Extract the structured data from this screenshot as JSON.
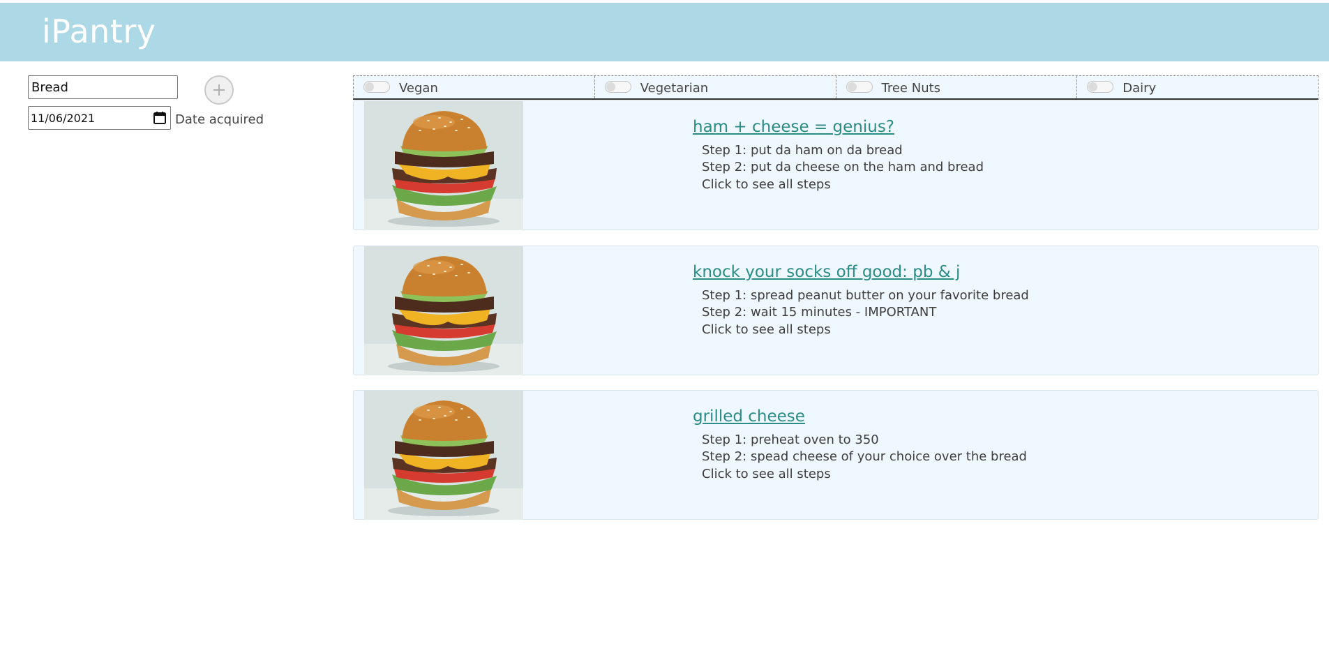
{
  "app": {
    "title": "iPantry"
  },
  "add_item": {
    "item_value": "Bread",
    "date_value": "11/06/2021",
    "date_label": "Date acquired"
  },
  "filters": [
    {
      "label": "Vegan",
      "on": false
    },
    {
      "label": "Vegetarian",
      "on": false
    },
    {
      "label": "Tree Nuts",
      "on": false
    },
    {
      "label": "Dairy",
      "on": false
    }
  ],
  "recipes": [
    {
      "title": "ham + cheese = genius?",
      "steps": [
        "Step 1: put da ham on da bread",
        "Step 2: put da cheese on the ham and bread"
      ],
      "see_all": "Click to see all steps"
    },
    {
      "title": "knock your socks off good: pb & j",
      "steps": [
        "Step 1: spread peanut butter on your favorite bread",
        "Step 2: wait 15 minutes - IMPORTANT"
      ],
      "see_all": "Click to see all steps"
    },
    {
      "title": "grilled cheese",
      "steps": [
        "Step 1: preheat oven to 350",
        "Step 2: spead cheese of your choice over the bread"
      ],
      "see_all": "Click to see all steps"
    }
  ],
  "colors": {
    "header": "#add8e6",
    "card_background": "#f0f8ff",
    "link": "#2a8c86"
  }
}
